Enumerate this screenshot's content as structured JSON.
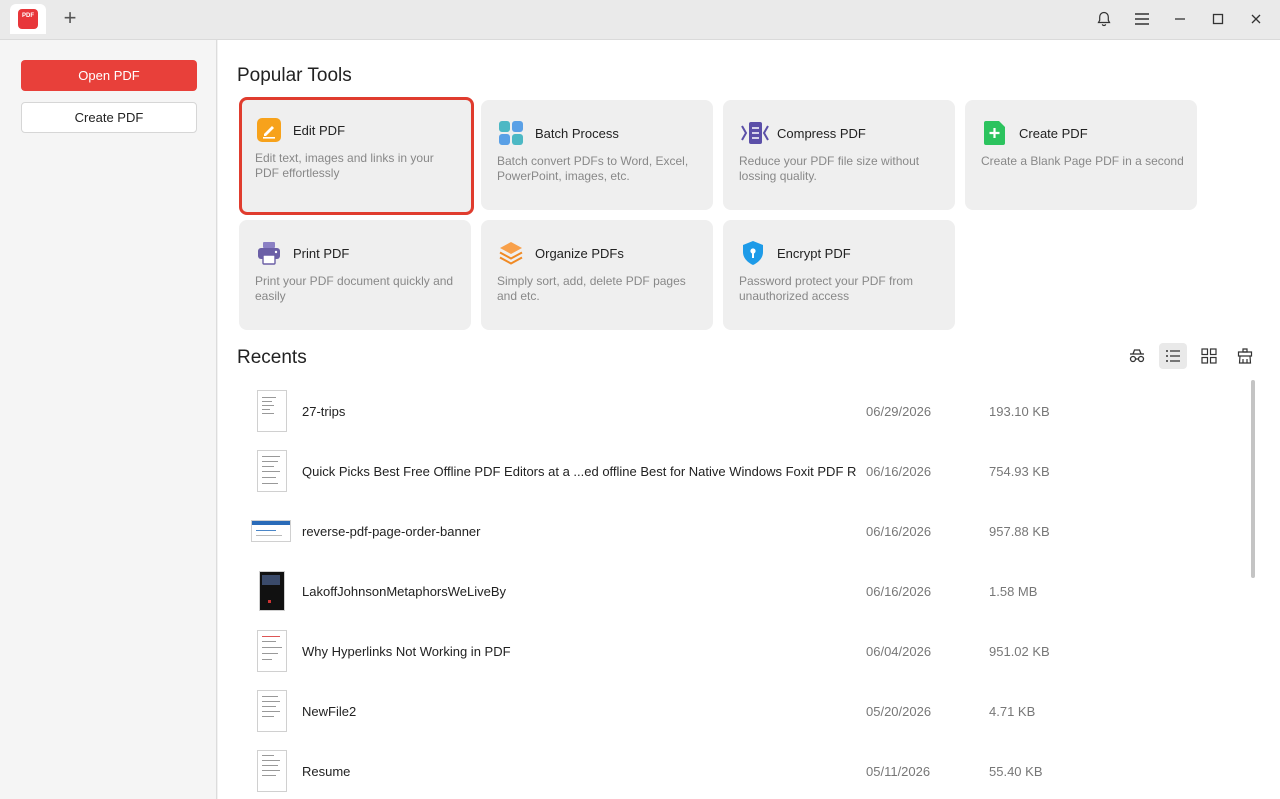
{
  "titlebar": {
    "logo_text": "PDF",
    "add_tab_label": "+"
  },
  "sidebar": {
    "open_label": "Open PDF",
    "create_label": "Create PDF"
  },
  "popular": {
    "title": "Popular Tools",
    "tools": [
      {
        "name": "Edit PDF",
        "desc": "Edit text, images and links in your PDF effortlessly",
        "icon": "edit-icon",
        "color": "#f7a21b"
      },
      {
        "name": "Batch Process",
        "desc": "Batch convert PDFs to Word, Excel, PowerPoint, images, etc.",
        "icon": "batch-icon",
        "color": "#4cb8c4"
      },
      {
        "name": "Compress PDF",
        "desc": "Reduce your PDF file size without lossing quality.",
        "icon": "compress-icon",
        "color": "#5b4fa8"
      },
      {
        "name": "Create PDF",
        "desc": "Create a Blank Page PDF in a second",
        "icon": "create-icon",
        "color": "#2cc35e"
      },
      {
        "name": "Print PDF",
        "desc": "Print your PDF document quickly and easily",
        "icon": "print-icon",
        "color": "#6b5fa6"
      },
      {
        "name": "Organize PDFs",
        "desc": "Simply sort, add, delete PDF pages and etc.",
        "icon": "organize-icon",
        "color": "#f08a24"
      },
      {
        "name": "Encrypt PDF",
        "desc": "Password protect your PDF from unauthorized access",
        "icon": "shield-icon",
        "color": "#1e9be8"
      }
    ]
  },
  "recents": {
    "title": "Recents",
    "files": [
      {
        "name": "27-trips",
        "date": "06/29/2026",
        "size": "193.10 KB"
      },
      {
        "name": "Quick Picks Best Free Offline PDF Editors at a ...ed offline Best for Native Windows Foxit PDF Re",
        "date": "06/16/2026",
        "size": "754.93 KB"
      },
      {
        "name": "reverse-pdf-page-order-banner",
        "date": "06/16/2026",
        "size": "957.88 KB"
      },
      {
        "name": "LakoffJohnsonMetaphorsWeLiveBy",
        "date": "06/16/2026",
        "size": "1.58 MB"
      },
      {
        "name": "Why Hyperlinks Not Working in PDF",
        "date": "06/04/2026",
        "size": "951.02 KB"
      },
      {
        "name": "NewFile2",
        "date": "05/20/2026",
        "size": "4.71 KB"
      },
      {
        "name": "Resume",
        "date": "05/11/2026",
        "size": "55.40 KB"
      }
    ]
  },
  "colors": {
    "accent": "#e8403a",
    "selection_border": "#e03c2e"
  }
}
